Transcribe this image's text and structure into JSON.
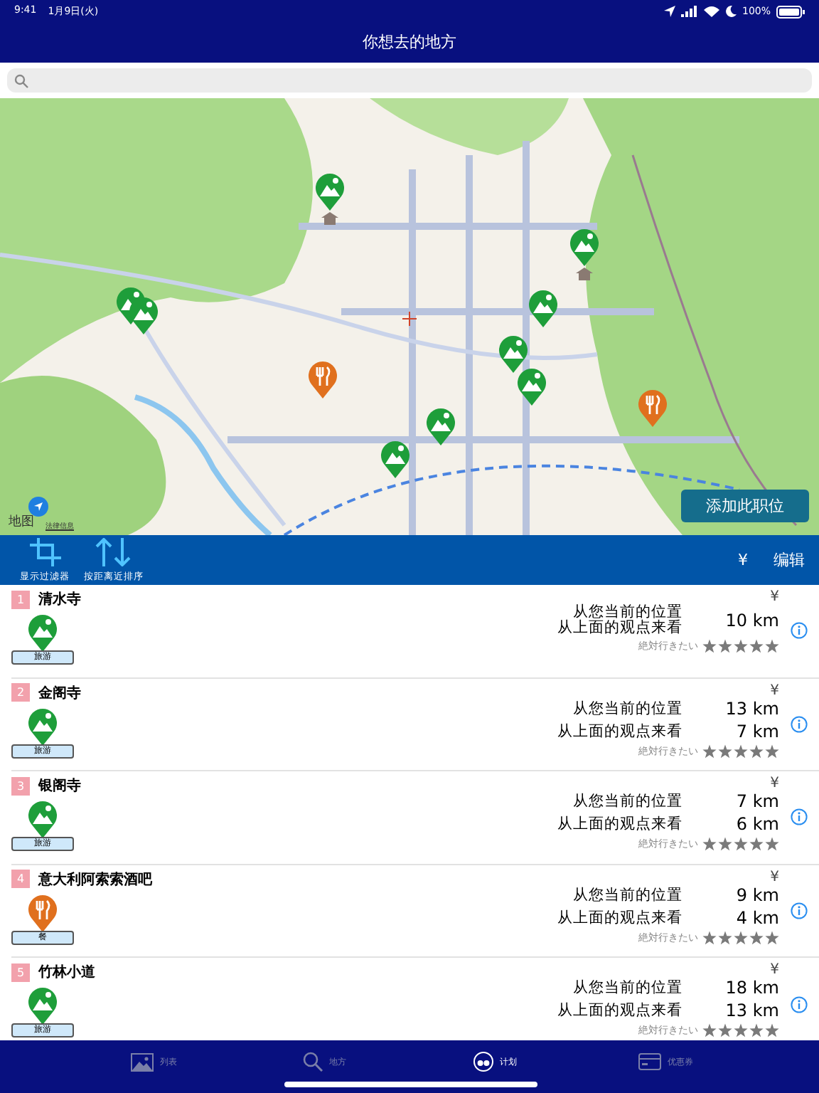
{
  "status_bar": {
    "time": "9:41",
    "date": "1月9日(火)",
    "battery": "100%"
  },
  "nav": {
    "title": "你想去的地方"
  },
  "map": {
    "pins": [
      {
        "kind": "sight",
        "temple": true
      },
      {
        "kind": "sight",
        "temple": true
      },
      {
        "kind": "sight",
        "temple": false
      },
      {
        "kind": "sight",
        "temple": false
      },
      {
        "kind": "sight",
        "temple": false
      },
      {
        "kind": "sight",
        "temple": false
      },
      {
        "kind": "sight",
        "temple": false
      },
      {
        "kind": "sight",
        "temple": false
      },
      {
        "kind": "sight",
        "temple": false
      },
      {
        "kind": "food",
        "temple": false
      },
      {
        "kind": "food",
        "temple": false
      }
    ],
    "logo": "地图",
    "legal": "法律信息",
    "add_button": "添加此职位"
  },
  "toolbar": {
    "tools": [
      {
        "kind": "filter",
        "label": "显示过滤器"
      },
      {
        "kind": "sort",
        "label": "按距离近排序"
      }
    ],
    "currency": "¥",
    "edit": "编辑"
  },
  "items": [
    {
      "number": "1",
      "name": "清水寺",
      "kind": "sight",
      "category": "旅游",
      "price": "¥",
      "from_here_label": "从您当前的位置",
      "from_here": "10 km",
      "from_prev_label": "从上面的观点来看",
      "rating_label": "絶対行きたい",
      "stars": 5
    },
    {
      "number": "2",
      "name": "金阁寺",
      "kind": "sight",
      "category": "旅游",
      "price": "¥",
      "from_here_label": "从您当前的位置",
      "from_here": "13 km",
      "from_prev_label": "从上面的观点来看",
      "from_prev": "7 km",
      "rating_label": "絶対行きたい",
      "stars": 5
    },
    {
      "number": "3",
      "name": "银阁寺",
      "kind": "sight",
      "category": "旅游",
      "price": "¥",
      "from_here_label": "从您当前的位置",
      "from_here": "7 km",
      "from_prev_label": "从上面的观点来看",
      "from_prev": "6 km",
      "rating_label": "絶対行きたい",
      "stars": 5
    },
    {
      "number": "4",
      "name": "意大利阿索索酒吧",
      "kind": "food",
      "category": "餐",
      "price": "¥",
      "from_here_label": "从您当前的位置",
      "from_here": "9 km",
      "from_prev_label": "从上面的观点来看",
      "from_prev": "4 km",
      "rating_label": "絶対行きたい",
      "stars": 5
    },
    {
      "number": "5",
      "name": "竹林小道",
      "kind": "sight",
      "category": "旅游",
      "price": "¥",
      "from_here_label": "从您当前的位置",
      "from_here": "18 km",
      "from_prev_label": "从上面的观点来看",
      "from_prev": "13 km",
      "rating_label": "絶対行きたい",
      "stars": 5
    }
  ],
  "tabs": [
    {
      "label": "列表",
      "selected": false
    },
    {
      "kind": "search",
      "label": "地方",
      "selected": false
    },
    {
      "kind": "binoculars",
      "label": "计划",
      "selected": true
    },
    {
      "kind": "card",
      "label": "优惠券",
      "selected": false
    }
  ]
}
